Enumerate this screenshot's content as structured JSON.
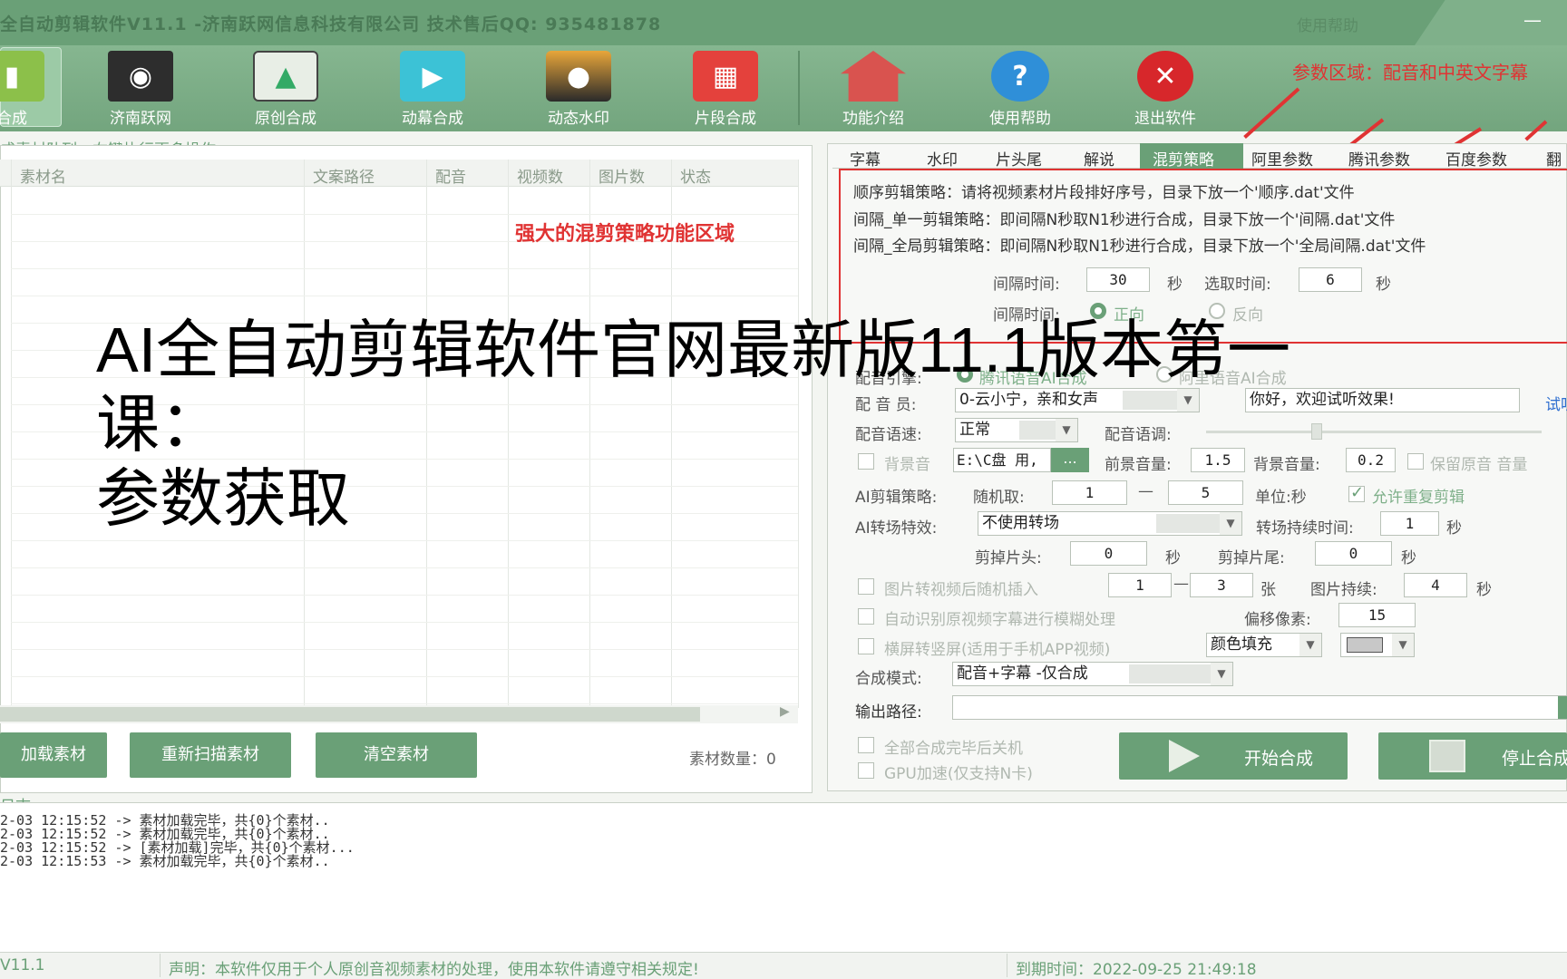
{
  "window": {
    "title": "全自动剪辑软件V11.1 -济南跃网信息科技有限公司 技术售后QQ: 935481878",
    "help": "使用帮助",
    "minimize": "—"
  },
  "toolbar": {
    "items": [
      {
        "label": "合成",
        "icon": "clapper-icon"
      },
      {
        "label": "济南跃网",
        "icon": "film-reel-icon"
      },
      {
        "label": "原创合成",
        "icon": "image-icon"
      },
      {
        "label": "动幕合成",
        "icon": "video-play-icon"
      },
      {
        "label": "动态水印",
        "icon": "sunset-icon"
      },
      {
        "label": "片段合成",
        "icon": "film-doc-icon"
      },
      {
        "label": "功能介绍",
        "icon": "home-icon"
      },
      {
        "label": "使用帮助",
        "icon": "help-icon"
      },
      {
        "label": "退出软件",
        "icon": "exit-icon"
      }
    ]
  },
  "annotations": {
    "params": "参数区域：配音和中英文字幕",
    "mix_area": "强大的混剪策略功能区域"
  },
  "queue": {
    "label": "成素材队列：右键执行更多操作",
    "columns": [
      "素材名",
      "文案路径",
      "配音",
      "视频数",
      "图片数",
      "状态"
    ],
    "buttons": {
      "load": "加载素材",
      "rescan": "重新扫描素材",
      "clear": "清空素材"
    },
    "count_label": "素材数量：0"
  },
  "tabs": [
    "字幕",
    "水印",
    "片头尾",
    "解说",
    "混剪策略",
    "阿里参数",
    "腾讯参数",
    "百度参数",
    "翻"
  ],
  "strategy": {
    "line1": "顺序剪辑策略：请将视频素材片段排好序号，目录下放一个'顺序.dat'文件",
    "line2": "间隔_单一剪辑策略：即间隔N秒取N1秒进行合成，目录下放一个'间隔.dat'文件",
    "line3": "间隔_全局剪辑策略：即间隔N秒取N1秒进行合成，目录下放一个'全局间隔.dat'文件",
    "interval_label": "间隔时间:",
    "interval_value": "30",
    "sec": "秒",
    "select_label": "选取时间:",
    "select_value": "6",
    "direction_label": "间隔时间:",
    "forward": "正向",
    "reverse": "反向"
  },
  "voice": {
    "engine_label": "配音引擎:",
    "engine_tencent": "腾讯语音AI合成",
    "engine_ali": "阿里语音AI合成",
    "speaker_label": "配 音 员:",
    "speaker_value": "0-云小宁，亲和女声",
    "preview_text": "你好，欢迎试听效果!",
    "preview_link": "试听",
    "speed_label": "配音语速:",
    "speed_value": "正常",
    "tone_label": "配音语调:"
  },
  "audio": {
    "bg_label": "背景音",
    "bg_path": "E:\\C盘 用,",
    "browse": "...",
    "fg_vol_label": "前景音量:",
    "fg_vol": "1.5",
    "bg_vol_label": "背景音量:",
    "bg_vol": "0.2",
    "keep_orig": "保留原音 音量"
  },
  "ai": {
    "strategy_label": "AI剪辑策略:",
    "random_label": "随机取:",
    "min": "1",
    "dash": "—",
    "max": "5",
    "unit": "单位:秒",
    "allow_repeat": "允许重复剪辑",
    "transition_label": "AI转场特效:",
    "transition_value": "不使用转场",
    "transition_dur_label": "转场持续时间:",
    "transition_dur": "1",
    "sec": "秒",
    "cut_head_label": "剪掉片头:",
    "cut_head": "0",
    "cut_tail_label": "剪掉片尾:",
    "cut_tail": "0"
  },
  "options": {
    "img_insert": "图片转视频后随机插入",
    "img_min": "1",
    "img_max": "3",
    "zhang": "张",
    "img_dur_label": "图片持续:",
    "img_dur": "4",
    "sec": "秒",
    "subtitle_blur": "自动识别原视频字幕进行模糊处理",
    "offset_label": "偏移像素:",
    "offset": "15",
    "portrait": "横屏转竖屏(适用于手机APP视频)",
    "fill_mode": "颜色填充"
  },
  "compose": {
    "mode_label": "合成模式:",
    "mode_value": "配音+字幕 -仅合成",
    "output_label": "输出路径:",
    "shutdown": "全部合成完毕后关机",
    "gpu": "GPU加速(仅支持N卡)",
    "start": "开始合成",
    "stop": "停止合成"
  },
  "log": {
    "title": "日志:",
    "lines": [
      "2-03 12:15:52 -> 素材加载完毕，共{0}个素材..",
      "2-03 12:15:52 -> 素材加载完毕，共{0}个素材..",
      "2-03 12:15:52 -> [素材加载]完毕，共{0}个素材...",
      "2-03 12:15:53 -> 素材加载完毕，共{0}个素材.."
    ]
  },
  "status": {
    "version": "V11.1",
    "notice": "声明：本软件仅用于个人原创音视频素材的处理，使用本软件请遵守相关规定!",
    "expiry": "到期时间：2022-09-25 21:49:18"
  },
  "overlay": {
    "line1": "AI全自动剪辑软件官网最新版11.1版本第一课：",
    "line2": "参数获取"
  },
  "colors": {
    "accent": "#6aa077",
    "annotation": "#e03333"
  }
}
